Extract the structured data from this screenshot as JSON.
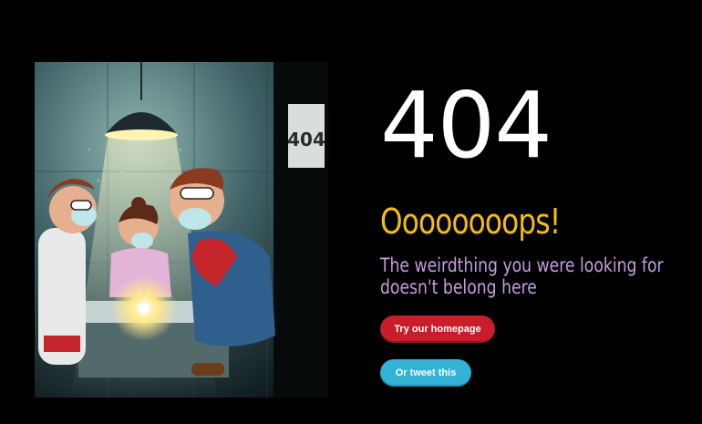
{
  "page": {
    "error_code": "404",
    "headline": "Oooooooops!",
    "message": "The weirdthing you were looking for doesn't belong here",
    "door_sign": "404"
  },
  "buttons": {
    "homepage_label": "Try our homepage",
    "tweet_label": "Or tweet this"
  },
  "colors": {
    "background": "#000000",
    "headline": "#f6be0b",
    "message": "#c79be0",
    "homepage_button": "#c81e2b",
    "tweet_button": "#32b3d6"
  },
  "illustration": {
    "description_icon": "lab-scientists-illustration"
  }
}
